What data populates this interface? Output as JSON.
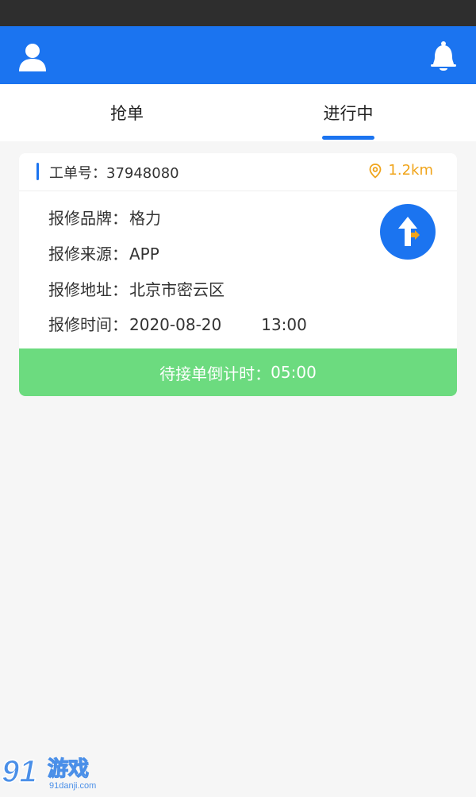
{
  "tabs": [
    {
      "label": "抢单",
      "active": false
    },
    {
      "label": "进行中",
      "active": true
    }
  ],
  "order": {
    "order_label": "工单号：",
    "order_number": "37948080",
    "distance": "1.2km",
    "fields": [
      {
        "label": "报修品牌：",
        "value": "格力"
      },
      {
        "label": "报修来源：",
        "value": "APP"
      },
      {
        "label": "报修地址：",
        "value": "北京市密云区"
      },
      {
        "label": "报修时间：",
        "value": "2020-08-20",
        "time": "13:00"
      }
    ],
    "countdown_label": "待接单倒计时：",
    "countdown_value": "05:00"
  },
  "icons": {
    "user": "user-icon",
    "bell": "bell-icon",
    "location": "location-pin-icon",
    "navigate": "navigation-arrow-icon"
  },
  "colors": {
    "primary": "#1b74f0",
    "accent_orange": "#f0a41a",
    "countdown_green": "#6cdb7f"
  },
  "watermark": {
    "text": "91游戏",
    "subtext": "91danji.com"
  }
}
